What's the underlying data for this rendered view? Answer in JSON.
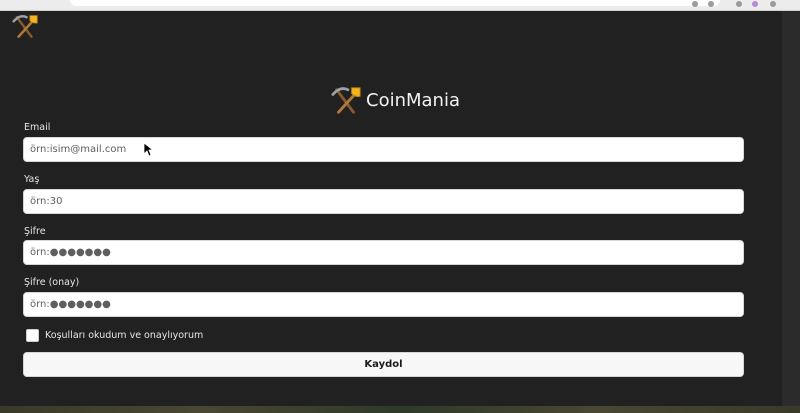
{
  "brand": {
    "name": "CoinMania",
    "logo_icon": "pick-shovel-icon"
  },
  "form": {
    "email": {
      "label": "Email",
      "placeholder": "örn:isim@mail.com"
    },
    "age": {
      "label": "Yaş",
      "placeholder": "örn:30"
    },
    "password": {
      "label": "Şifre",
      "placeholder": "örn:●●●●●●●"
    },
    "password_confirm": {
      "label": "Şifre (onay)",
      "placeholder": "örn:●●●●●●●"
    },
    "terms": {
      "label": "Koşulları okudum ve onaylıyorum",
      "checked": false
    },
    "submit_label": "Kaydol"
  },
  "colors": {
    "background": "#212121",
    "input_background": "#ffffff",
    "text": "#e6e6e6"
  }
}
